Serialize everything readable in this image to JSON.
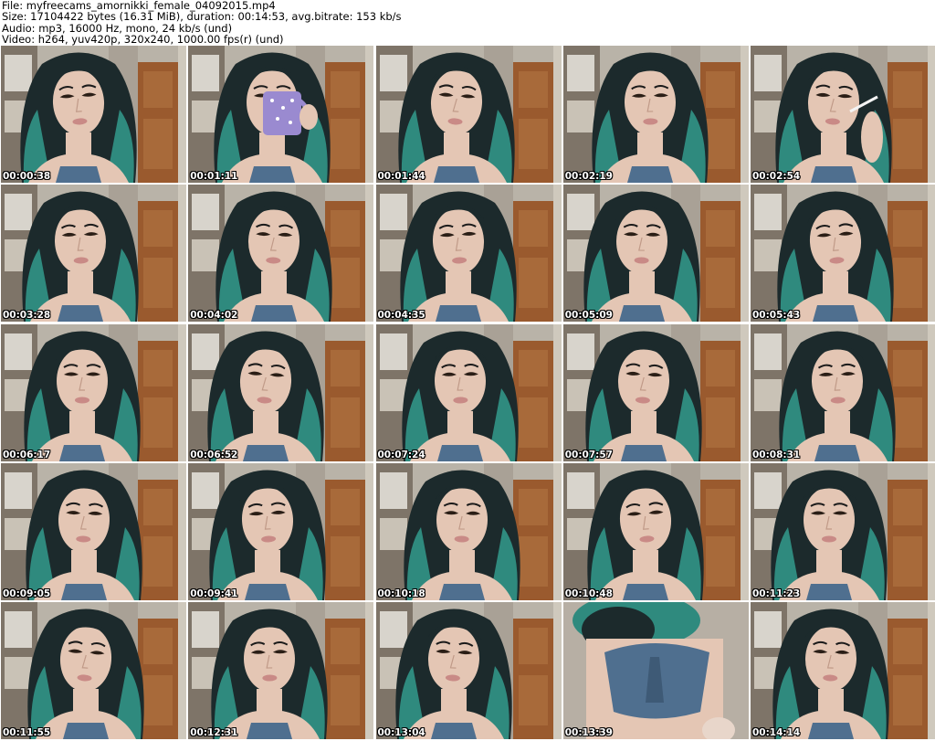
{
  "header": {
    "file_line": "File: myfreecams_amornikki_female_04092015.mp4",
    "size_line": "Size: 17104422 bytes (16.31 MiB), duration: 00:14:53, avg.bitrate: 153 kb/s",
    "audio_line": "Audio: mp3, 16000 Hz, mono, 24 kb/s (und)",
    "video_line": "Video: h264, yuv420p, 320x240, 1000.00 fps(r) (und)"
  },
  "thumbnails": [
    {
      "time": "00:00:38",
      "variant": "face"
    },
    {
      "time": "00:01:11",
      "variant": "mug"
    },
    {
      "time": "00:01:44",
      "variant": "face"
    },
    {
      "time": "00:02:19",
      "variant": "face"
    },
    {
      "time": "00:02:54",
      "variant": "cigarette"
    },
    {
      "time": "00:03:28",
      "variant": "face"
    },
    {
      "time": "00:04:02",
      "variant": "face"
    },
    {
      "time": "00:04:35",
      "variant": "face"
    },
    {
      "time": "00:05:09",
      "variant": "face"
    },
    {
      "time": "00:05:43",
      "variant": "face"
    },
    {
      "time": "00:06:17",
      "variant": "face"
    },
    {
      "time": "00:06:52",
      "variant": "face"
    },
    {
      "time": "00:07:24",
      "variant": "face"
    },
    {
      "time": "00:07:57",
      "variant": "face"
    },
    {
      "time": "00:08:31",
      "variant": "face"
    },
    {
      "time": "00:09:05",
      "variant": "face"
    },
    {
      "time": "00:09:41",
      "variant": "face"
    },
    {
      "time": "00:10:18",
      "variant": "face"
    },
    {
      "time": "00:10:48",
      "variant": "face"
    },
    {
      "time": "00:11:23",
      "variant": "face"
    },
    {
      "time": "00:11:55",
      "variant": "face"
    },
    {
      "time": "00:12:31",
      "variant": "face"
    },
    {
      "time": "00:13:04",
      "variant": "face"
    },
    {
      "time": "00:13:39",
      "variant": "torso"
    },
    {
      "time": "00:14:14",
      "variant": "face"
    }
  ],
  "colors": {
    "hair_dark": "#1c2a2c",
    "hair_teal": "#2f8a7e",
    "skin": "#e4c6b4",
    "shirt": "#4f6f8f",
    "door": "#9a5a2e",
    "wall": "#b9b3a8",
    "timestamp": "#ffffff"
  }
}
